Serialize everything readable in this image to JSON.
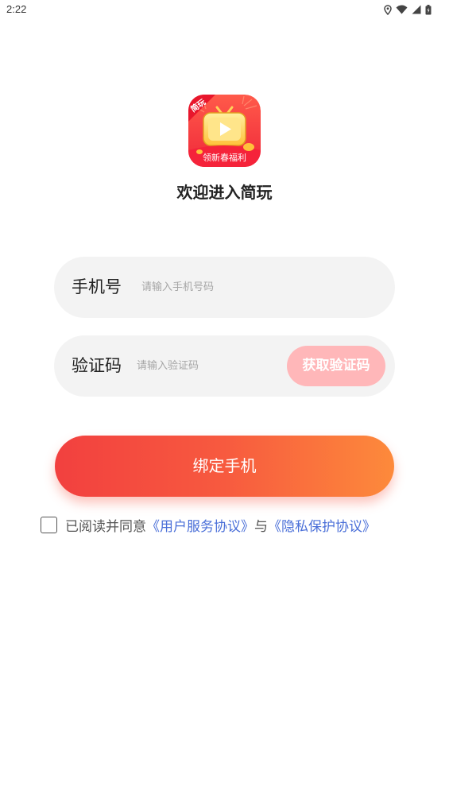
{
  "status_bar": {
    "time": "2:22",
    "icons": [
      "location-icon",
      "wifi-icon",
      "signal-icon",
      "battery-icon"
    ]
  },
  "app": {
    "logo_tag": "简玩",
    "logo_caption": "领新春福利",
    "welcome": "欢迎进入简玩"
  },
  "phone_field": {
    "label": "手机号",
    "placeholder": "请输入手机号码",
    "value": ""
  },
  "code_field": {
    "label": "验证码",
    "placeholder": "请输入验证码",
    "value": "",
    "get_code_label": "获取验证码"
  },
  "bind_button": {
    "label": "绑定手机"
  },
  "agreement": {
    "checked": false,
    "prefix": "已阅读并同意",
    "user_agreement": "《用户服务协议》",
    "and": "与",
    "privacy_policy": "《隐私保护协议》"
  },
  "colors": {
    "primary_gradient_start": "#f2403f",
    "primary_gradient_end": "#fd8a3b",
    "get_code_bg": "#ffb7b9",
    "link": "#4a6fd8",
    "field_bg": "#f3f3f3"
  }
}
